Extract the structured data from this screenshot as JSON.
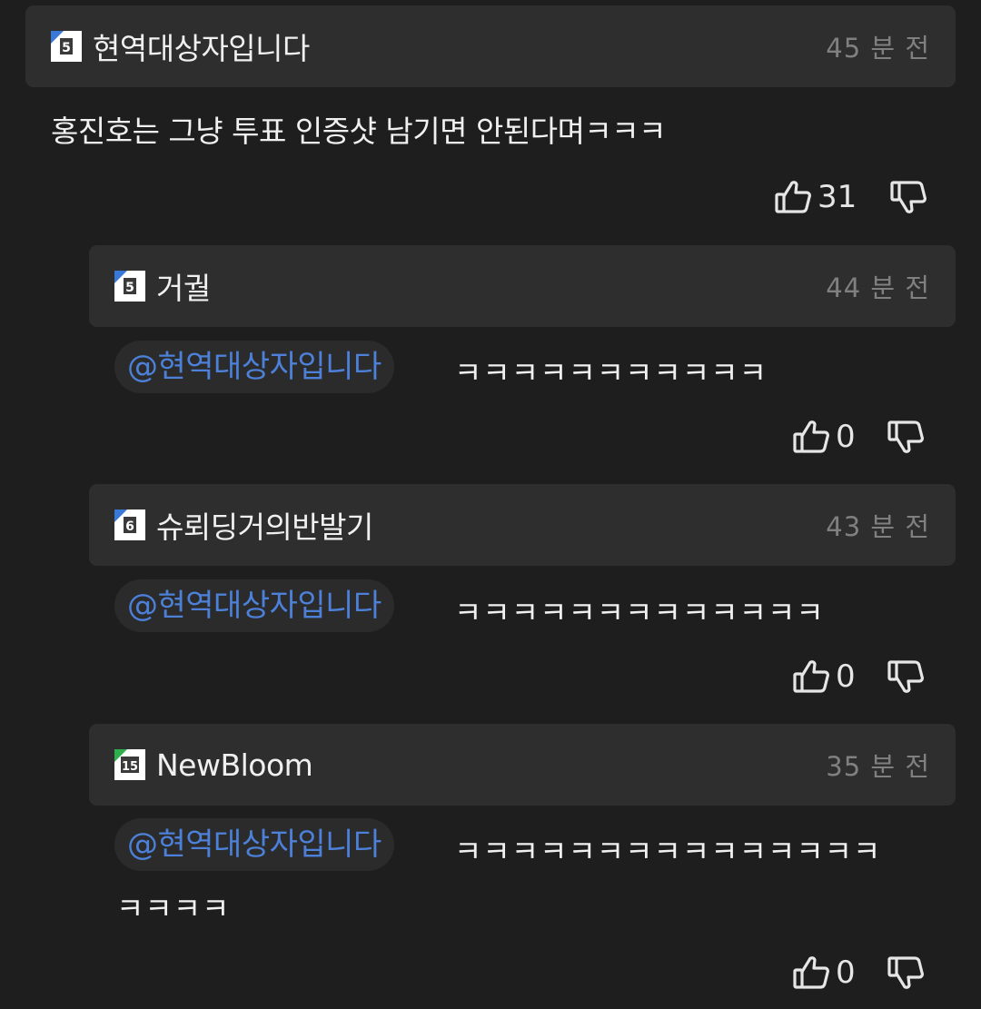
{
  "comment": {
    "username": "현역대상자입니다",
    "level": "5",
    "time": "45 분 전",
    "text": "홍진호는 그냥 투표 인증샷 남기면 안된다며ㅋㅋㅋ",
    "likes": "31"
  },
  "replies": [
    {
      "username": "거궐",
      "level": "5",
      "time": "44 분 전",
      "mention": "@현역대상자입니다",
      "text_line1": "ㅋㅋㅋㅋㅋㅋㅋㅋㅋㅋㅋ",
      "text_line2": "",
      "likes": "0"
    },
    {
      "username": "슈뢰딩거의반발기",
      "level": "6",
      "time": "43 분 전",
      "mention": "@현역대상자입니다",
      "text_line1": "ㅋㅋㅋㅋㅋㅋㅋㅋㅋㅋㅋㅋㅋ",
      "text_line2": "",
      "likes": "0"
    },
    {
      "username": "NewBloom",
      "level": "15",
      "time": "35 분 전",
      "mention": "@현역대상자입니다",
      "text_line1": "ㅋㅋㅋㅋㅋㅋㅋㅋㅋㅋㅋㅋㅋㅋㅋ",
      "text_line2": "ㅋㅋㅋㅋ",
      "likes": "0"
    }
  ],
  "colors": {
    "background": "#1e1e1e",
    "header": "#2e2e2e",
    "mention": "#4c80d9",
    "level_blue": "#3a78d8",
    "level_green": "#2fae4e"
  }
}
